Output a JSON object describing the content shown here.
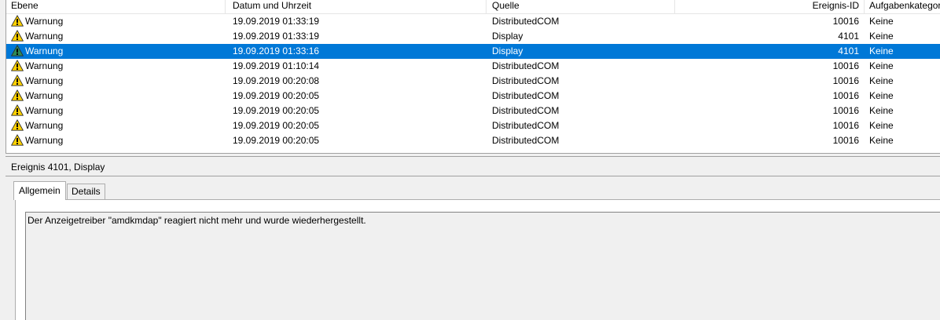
{
  "columns": {
    "level": "Ebene",
    "datetime": "Datum und Uhrzeit",
    "source": "Quelle",
    "event_id": "Ereignis-ID",
    "category": "Aufgabenkategor"
  },
  "events": [
    {
      "level": "Warnung",
      "datetime": "19.09.2019 01:33:19",
      "source": "DistributedCOM",
      "event_id": "10016",
      "category": "Keine",
      "selected": false
    },
    {
      "level": "Warnung",
      "datetime": "19.09.2019 01:33:19",
      "source": "Display",
      "event_id": "4101",
      "category": "Keine",
      "selected": false
    },
    {
      "level": "Warnung",
      "datetime": "19.09.2019 01:33:16",
      "source": "Display",
      "event_id": "4101",
      "category": "Keine",
      "selected": true
    },
    {
      "level": "Warnung",
      "datetime": "19.09.2019 01:10:14",
      "source": "DistributedCOM",
      "event_id": "10016",
      "category": "Keine",
      "selected": false
    },
    {
      "level": "Warnung",
      "datetime": "19.09.2019 00:20:08",
      "source": "DistributedCOM",
      "event_id": "10016",
      "category": "Keine",
      "selected": false
    },
    {
      "level": "Warnung",
      "datetime": "19.09.2019 00:20:05",
      "source": "DistributedCOM",
      "event_id": "10016",
      "category": "Keine",
      "selected": false
    },
    {
      "level": "Warnung",
      "datetime": "19.09.2019 00:20:05",
      "source": "DistributedCOM",
      "event_id": "10016",
      "category": "Keine",
      "selected": false
    },
    {
      "level": "Warnung",
      "datetime": "19.09.2019 00:20:05",
      "source": "DistributedCOM",
      "event_id": "10016",
      "category": "Keine",
      "selected": false
    },
    {
      "level": "Warnung",
      "datetime": "19.09.2019 00:20:05",
      "source": "DistributedCOM",
      "event_id": "10016",
      "category": "Keine",
      "selected": false
    }
  ],
  "detail": {
    "title": "Ereignis 4101, Display",
    "tabs": [
      "Allgemein",
      "Details"
    ],
    "active_tab": "Allgemein",
    "message": "Der Anzeigetreiber \"amdkmdap\" reagiert nicht mehr und wurde wiederhergestellt."
  },
  "colors": {
    "selection": "#0078d7",
    "warning_fill": "#ffd100",
    "warning_fill_selected": "#2e8b57"
  },
  "icons": {
    "level": "warning-icon"
  }
}
